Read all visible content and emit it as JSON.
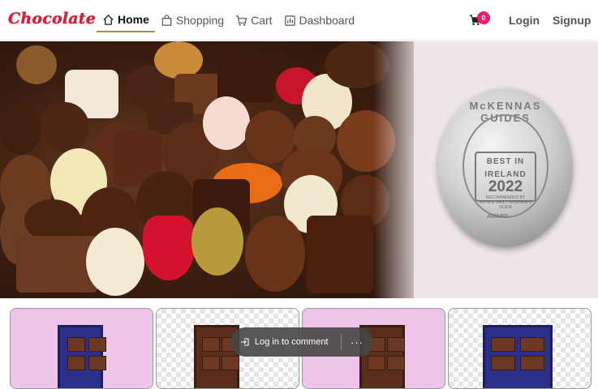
{
  "brand": {
    "logo_text": "Chocolate",
    "accent": "#d81e3a"
  },
  "nav": {
    "items": [
      {
        "label": "Home",
        "icon": "home-icon",
        "active": true
      },
      {
        "label": "Shopping",
        "icon": "bag-icon",
        "active": false
      },
      {
        "label": "Cart",
        "icon": "cart-icon",
        "active": false
      },
      {
        "label": "Dashboard",
        "icon": "dashboard-icon",
        "active": false
      }
    ],
    "cart_count": "0",
    "login": "Login",
    "signup": "Signup",
    "badge_color": "#f0196b"
  },
  "hero": {
    "coin": {
      "arc_text": "McKENNAS GUIDES",
      "best_in": "BEST IN",
      "ireland": "IRELAND",
      "year": "2022",
      "recommended": "RECOMMENDED BY",
      "by": "JOHN & SALLY McKENNA'S",
      "guide": "GUIDE",
      "award": "AWARD"
    }
  },
  "overlay": {
    "login_to_comment": "Log in to comment",
    "more": "···"
  }
}
